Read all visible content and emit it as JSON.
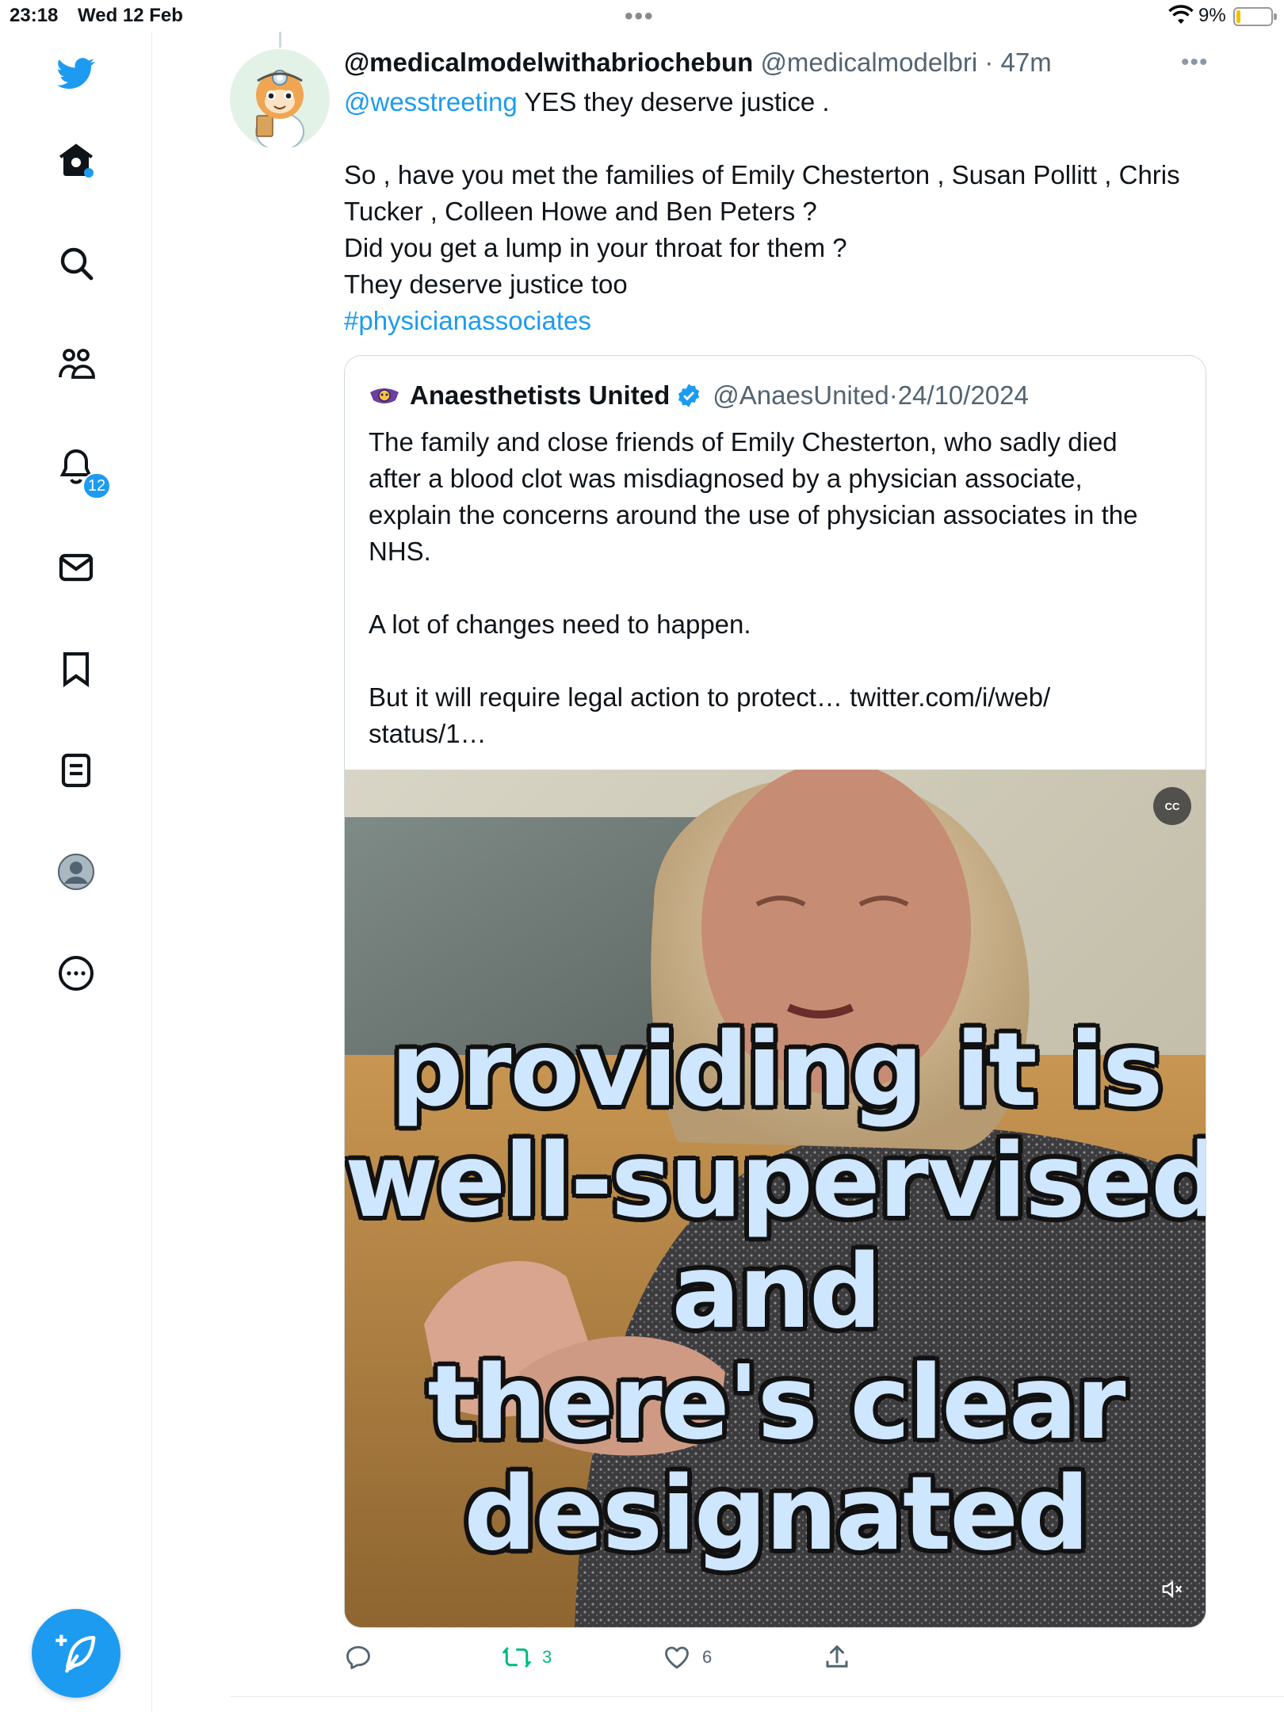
{
  "status_bar": {
    "time": "23:18",
    "date": "Wed 12 Feb",
    "battery_percent": "9%",
    "battery_level": 0.09,
    "multitask_dots": "•••"
  },
  "sidebar": {
    "icons": [
      "twitter-bird-icon",
      "home-icon",
      "search-icon",
      "communities-icon",
      "notifications-icon",
      "messages-icon",
      "bookmarks-icon",
      "lists-icon",
      "profile-icon",
      "more-icon"
    ],
    "notifications_badge": "12",
    "compose_icon": "feather-plus-icon"
  },
  "tweet": {
    "display_name": "@medicalmodelwithabriochebun",
    "handle": "@medicalmodelbri",
    "separator": " · ",
    "time": "47m",
    "more": "•••",
    "mention": "@wesstreeting",
    "line1_rest": " YES they deserve justice .",
    "paragraph2": "So , have you met the families of Emily Chesterton , Susan Pollitt , Chris\nTucker , Colleen Howe and Ben Peters ?\nDid you get a lump in your throat for them ?\nThey deserve justice too",
    "hashtag": "#physicianassociates"
  },
  "quote": {
    "display_name": "Anaesthetists United",
    "verified": true,
    "handle": "@AnaesUnited",
    "separator": " · ",
    "date": "24/10/2024",
    "paragraph1": "The family and close friends of Emily Chesterton, who sadly died\nafter a blood clot was misdiagnosed by a physician associate,\nexplain the concerns around the use of physician associates in the\nNHS.",
    "paragraph2": "A lot of changes need to happen.",
    "paragraph3": "But it will require legal action to protect… twitter.com/i/web/\nstatus/1…",
    "video": {
      "captions": [
        "providing it is",
        "well-supervised",
        "and",
        "there's clear",
        "designated"
      ],
      "cc_label": "CC"
    }
  },
  "actions": {
    "reply_count": "",
    "retweet_count": "3",
    "like_count": "6",
    "accent_color": "#1d9bf0",
    "retweet_color": "#00ba7c"
  }
}
